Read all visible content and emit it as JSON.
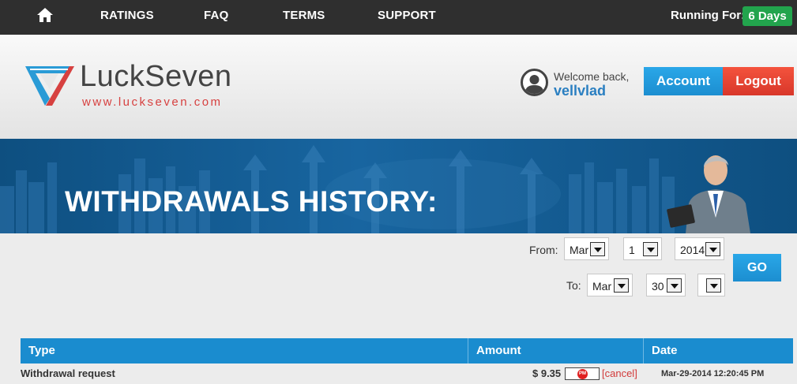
{
  "nav": {
    "home_icon": "home-icon",
    "links": [
      "RATINGS",
      "FAQ",
      "TERMS",
      "SUPPORT"
    ],
    "running_label": "Running For:",
    "running_value": "6 Days"
  },
  "brand": {
    "name": "LuckSeven",
    "url": "www.luckseven.com",
    "colors": {
      "blue": "#2a9bd6",
      "red": "#d74140"
    }
  },
  "user": {
    "welcome": "Welcome back,",
    "username": "vellvlad",
    "avatar_icon": "user-avatar-icon"
  },
  "buttons": {
    "account": "Account",
    "logout": "Logout",
    "go": "GO"
  },
  "banner": {
    "title": "WITHDRAWALS HISTORY:"
  },
  "filters": {
    "from_label": "From:",
    "from_month": "Mar",
    "from_day": "1",
    "from_year": "2014",
    "to_label": "To:",
    "to_month": "Mar",
    "to_day": "30",
    "to_year": ""
  },
  "table": {
    "columns": [
      "Type",
      "Amount",
      "Date"
    ],
    "rows": [
      {
        "type": "Withdrawal request",
        "amount": "$ 9.35",
        "payment_icon": "perfect-money-icon",
        "payment_badge": "PM",
        "action": "[cancel]",
        "date": "Mar-29-2014 12:20:45 PM"
      }
    ]
  },
  "colors": {
    "accent": "#1a8ccf",
    "danger": "#e0432f",
    "success": "#22a44d",
    "nav_bg": "#2f2f2f"
  }
}
